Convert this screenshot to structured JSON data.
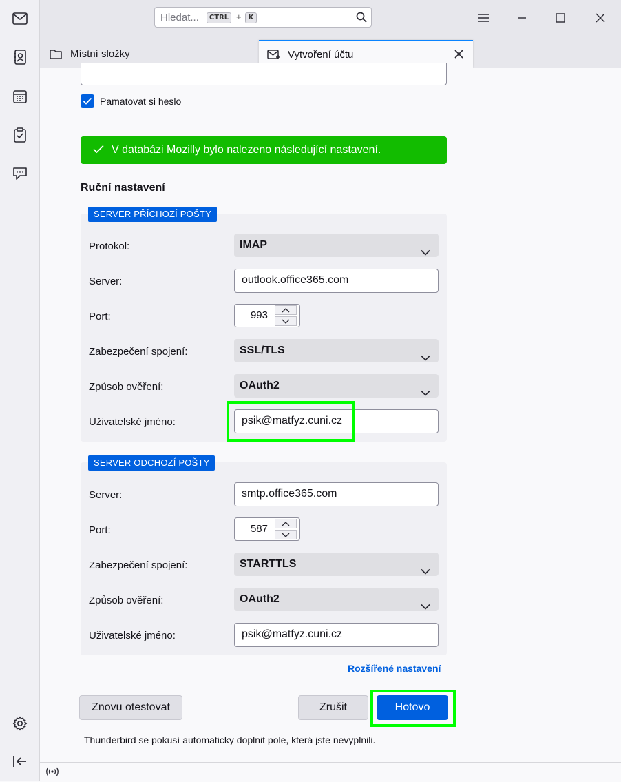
{
  "colors": {
    "accent": "#0060df",
    "success": "#12bc00",
    "highlight": "#00ff00"
  },
  "spaces": [
    "mail-icon",
    "address-book-icon",
    "calendar-icon",
    "tasks-icon",
    "chat-icon",
    "settings-icon",
    "collapse-icon"
  ],
  "search": {
    "placeholder": "Hledat...",
    "key1": "CTRL",
    "plus": "+",
    "key2": "K"
  },
  "tabs": [
    {
      "label": "Místní složky",
      "icon": "folder-icon"
    },
    {
      "label": "Vytvoření účtu",
      "icon": "new-mail-icon",
      "active": true
    }
  ],
  "form": {
    "remember_password": "Pamatovat si heslo",
    "remember_checked": true,
    "success_message": "V databázi Mozilly bylo nalezeno následující nastavení.",
    "manual_title": "Ruční nastavení",
    "incoming": {
      "badge": "SERVER PŘÍCHOZÍ POŠTY",
      "protocol_label": "Protokol:",
      "protocol": "IMAP",
      "server_label": "Server:",
      "server": "outlook.office365.com",
      "port_label": "Port:",
      "port": "993",
      "security_label": "Zabezpečení spojení:",
      "security": "SSL/TLS",
      "auth_label": "Způsob ověření:",
      "auth": "OAuth2",
      "username_label": "Uživatelské jméno:",
      "username": "psik@matfyz.cuni.cz"
    },
    "outgoing": {
      "badge": "SERVER ODCHOZÍ POŠTY",
      "server_label": "Server:",
      "server": "smtp.office365.com",
      "port_label": "Port:",
      "port": "587",
      "security_label": "Zabezpečení spojení:",
      "security": "STARTTLS",
      "auth_label": "Způsob ověření:",
      "auth": "OAuth2",
      "username_label": "Uživatelské jméno:",
      "username": "psik@matfyz.cuni.cz"
    },
    "advanced_link": "Rozšířené nastavení",
    "retest_button": "Znovu otestovat",
    "cancel_button": "Zrušit",
    "done_button": "Hotovo",
    "footer_note": "Thunderbird se pokusí automaticky doplnit pole, která jste nevyplnili."
  }
}
